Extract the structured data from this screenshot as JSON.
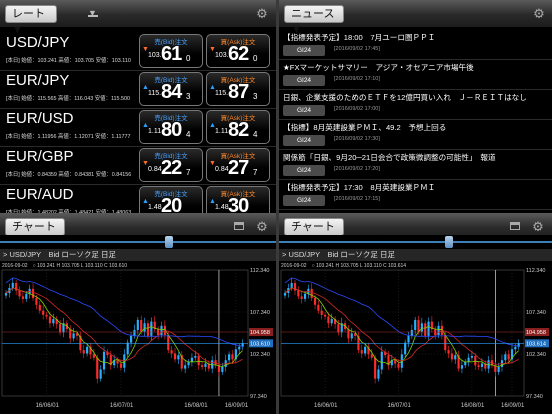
{
  "rates_panel": {
    "dropdown_label": "レート ▼",
    "rows": [
      {
        "pair": "USD/JPY",
        "info": "[本日] 始値：103.241  高値：103.705  安値：103.110",
        "bid": {
          "label": "売(Bid)注文",
          "arrow": "▼",
          "dir": "down",
          "small": "103.",
          "big": "61",
          "tiny": "0"
        },
        "ask": {
          "label": "買(Ask)注文",
          "arrow": "▼",
          "dir": "down",
          "small": "103.",
          "big": "62",
          "tiny": "0"
        }
      },
      {
        "pair": "EUR/JPY",
        "info": "[本日] 始値：115.565  高値：116.043  安値：115.500",
        "bid": {
          "label": "売(Bid)注文",
          "arrow": "▲",
          "dir": "up",
          "small": "115.",
          "big": "84",
          "tiny": "3"
        },
        "ask": {
          "label": "買(Ask)注文",
          "arrow": "▲",
          "dir": "up",
          "small": "115.",
          "big": "87",
          "tiny": "3"
        }
      },
      {
        "pair": "EUR/USD",
        "info": "[本日] 始値：1.11956  高値：1.12071  安値：1.11777",
        "bid": {
          "label": "売(Bid)注文",
          "arrow": "▲",
          "dir": "up",
          "small": "1.11",
          "big": "80",
          "tiny": "4"
        },
        "ask": {
          "label": "買(Ask)注文",
          "arrow": "▲",
          "dir": "up",
          "small": "1.11",
          "big": "82",
          "tiny": "4"
        }
      },
      {
        "pair": "EUR/GBP",
        "info": "[本日] 始値：0.84359  高値：0.84381  安値：0.84156",
        "bid": {
          "label": "売(Bid)注文",
          "arrow": "▼",
          "dir": "down",
          "small": "0.84",
          "big": "22",
          "tiny": "7"
        },
        "ask": {
          "label": "買(Ask)注文",
          "arrow": "▼",
          "dir": "down",
          "small": "0.84",
          "big": "27",
          "tiny": "7"
        }
      },
      {
        "pair": "EUR/AUD",
        "info": "[本日] 始値：1.48202  高値：1.48421  安値：1.48063",
        "bid": {
          "label": "売(Bid)注文",
          "arrow": "▲",
          "dir": "up",
          "small": "1.48",
          "big": "20",
          "tiny": ""
        },
        "ask": {
          "label": "買(Ask)注文",
          "arrow": "▲",
          "dir": "up",
          "small": "1.48",
          "big": "30",
          "tiny": ""
        }
      }
    ]
  },
  "news_panel": {
    "dropdown_label": "ニュース ▼",
    "items": [
      {
        "title": "【指標発表予定】18:00　7月ユーロ圏ＰＰＩ",
        "source": "GI24",
        "date": "[2016/09/02 17:45]"
      },
      {
        "title": "★FXマーケットサマリー　アジア・オセアニア市場午後",
        "source": "GI24",
        "date": "[2016/09/02 17:10]"
      },
      {
        "title": "日銀、企業支援のためのＥＴＦを12億円買い入れ　Ｊ－ＲＥＩＴはなし",
        "source": "GI24",
        "date": "[2016/09/02 17:00]"
      },
      {
        "title": "【指標】8月英建設業ＰＭＩ、49.2　予想上回る",
        "source": "GI24",
        "date": "[2016/09/02 17:30]"
      },
      {
        "title": "関係筋「日銀、9月20─21日会合で政策微調整の可能性」　報道",
        "source": "GI24",
        "date": "[2016/09/02 17:20]"
      },
      {
        "title": "【指標発表予定】17:30　8月英建設業ＰＭＩ",
        "source": "GI24",
        "date": "[2016/09/02 17:15]"
      }
    ]
  },
  "charts": [
    {
      "dropdown_label": "チャート ▼",
      "title": "> USD/JPY　Bid ローソク足 日足",
      "ohlc": "2016-09-02　○ 103.241  H 103.705  L 103.110  C 103.610",
      "y_ticks": [
        "112.340",
        "107.340",
        "102.340",
        "97.340"
      ],
      "price_tag_red": "104.958",
      "price_tag_blue": "103.610",
      "x_ticks": [
        "16/06/01",
        "16/07/01",
        "16/08/01",
        "16/09/01"
      ]
    },
    {
      "dropdown_label": "チャート ▼",
      "title": "> USD/JPY　Bid ローソク足 日足",
      "ohlc": "2016-09-02　○ 103.241  H 103.705  L 103.110  C 103.614",
      "y_ticks": [
        "112.340",
        "107.340",
        "102.340",
        "97.340"
      ],
      "price_tag_red": "104.958",
      "price_tag_blue": "103.614",
      "x_ticks": [
        "16/06/01",
        "16/07/01",
        "16/08/01",
        "16/09/01"
      ]
    }
  ],
  "chart_data": {
    "type": "candlestick",
    "title": "USD/JPY Bid ローソク足 日足",
    "ylim": [
      97.34,
      112.34
    ],
    "x_ticks": [
      "16/06/01",
      "16/07/01",
      "16/08/01",
      "16/09/01"
    ],
    "closes": [
      109.6,
      110.2,
      110.8,
      109.9,
      109.2,
      108.9,
      109.5,
      110.1,
      109.0,
      108.2,
      107.5,
      107.0,
      106.8,
      106.0,
      106.5,
      105.9,
      104.9,
      106.0,
      105.3,
      104.2,
      104.8,
      104.5,
      102.8,
      102.4,
      103.2,
      102.3,
      101.9,
      99.4,
      100.5,
      102.6,
      102.2,
      101.0,
      101.6,
      101.2,
      100.7,
      102.3,
      103.7,
      104.5,
      105.2,
      106.4,
      105.0,
      106.0,
      104.5,
      106.2,
      105.3,
      104.6,
      105.7,
      104.6,
      102.8,
      102.4,
      101.7,
      102.2,
      100.6,
      101.0,
      101.4,
      101.9,
      102.1,
      101.0,
      100.8,
      101.2,
      100.6,
      101.6,
      101.0,
      100.2,
      100.8,
      101.6,
      102.3,
      101.7,
      102.9,
      103.2,
      103.6
    ],
    "ma_series": [
      "green",
      "red",
      "blue"
    ],
    "colors": {
      "up": "#29b0ff",
      "down": "#ff2b2b",
      "ma_green": "#7fd500",
      "ma_red": "#d62828",
      "ma_blue": "#2b4bff",
      "last_line": "#2b9fff"
    }
  }
}
